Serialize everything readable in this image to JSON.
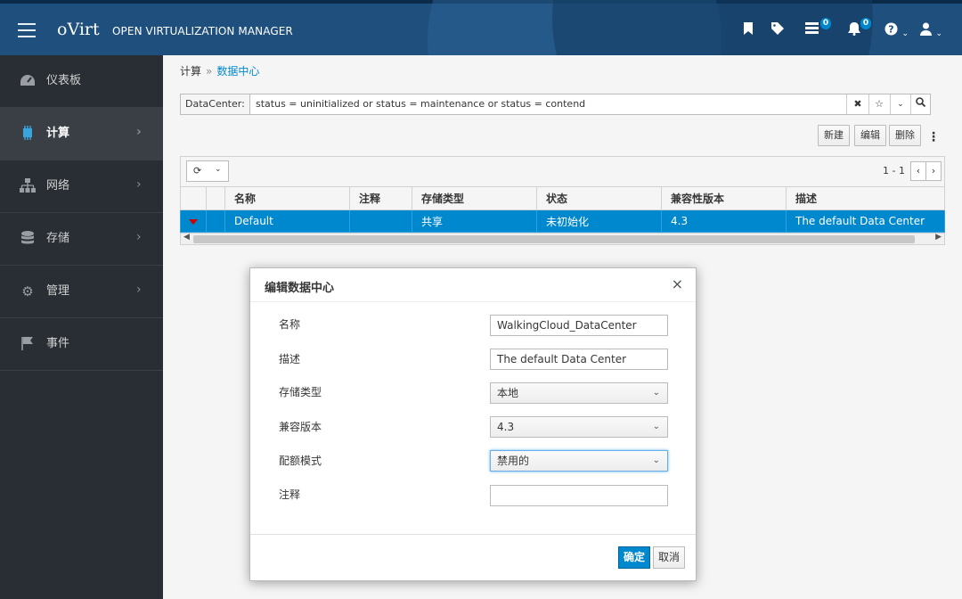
{
  "header": {
    "logo": "oVirt",
    "product": "OPEN VIRTUALIZATION MANAGER",
    "events_count": "0",
    "alerts_count": "0"
  },
  "sidebar": {
    "items": [
      {
        "label": "仪表板",
        "icon": "dashboard-icon"
      },
      {
        "label": "计算",
        "icon": "chip-icon"
      },
      {
        "label": "网络",
        "icon": "network-icon"
      },
      {
        "label": "存储",
        "icon": "database-icon"
      },
      {
        "label": "管理",
        "icon": "gear-icon"
      },
      {
        "label": "事件",
        "icon": "flag-icon"
      }
    ]
  },
  "breadcrumb": {
    "parent": "计算",
    "separator": "»",
    "current": "数据中心"
  },
  "search": {
    "prefix": "DataCenter:",
    "query": "status = uninitialized or status = maintenance or status = contend"
  },
  "toolbar": {
    "new": "新建",
    "edit": "编辑",
    "remove": "删除"
  },
  "pager": {
    "range": "1 - 1"
  },
  "grid": {
    "columns": [
      "名称",
      "注释",
      "存储类型",
      "状态",
      "兼容性版本",
      "描述"
    ],
    "rows": [
      {
        "name": "Default",
        "comment": "",
        "storage_type": "共享",
        "status": "未初始化",
        "version": "4.3",
        "description": "The default Data Center"
      }
    ]
  },
  "modal": {
    "title": "编辑数据中心",
    "fields": {
      "name_label": "名称",
      "name_value": "WalkingCloud_DataCenter",
      "description_label": "描述",
      "description_value": "The default Data Center",
      "storage_label": "存储类型",
      "storage_value": "本地",
      "version_label": "兼容版本",
      "version_value": "4.3",
      "quota_label": "配额模式",
      "quota_value": "禁用的",
      "comment_label": "注释",
      "comment_value": ""
    },
    "ok": "确定",
    "cancel": "取消"
  },
  "colors": {
    "accent": "#0088ce",
    "header": "#1f4f7c",
    "sidebar": "#292e34",
    "warning": "#cc0000"
  }
}
